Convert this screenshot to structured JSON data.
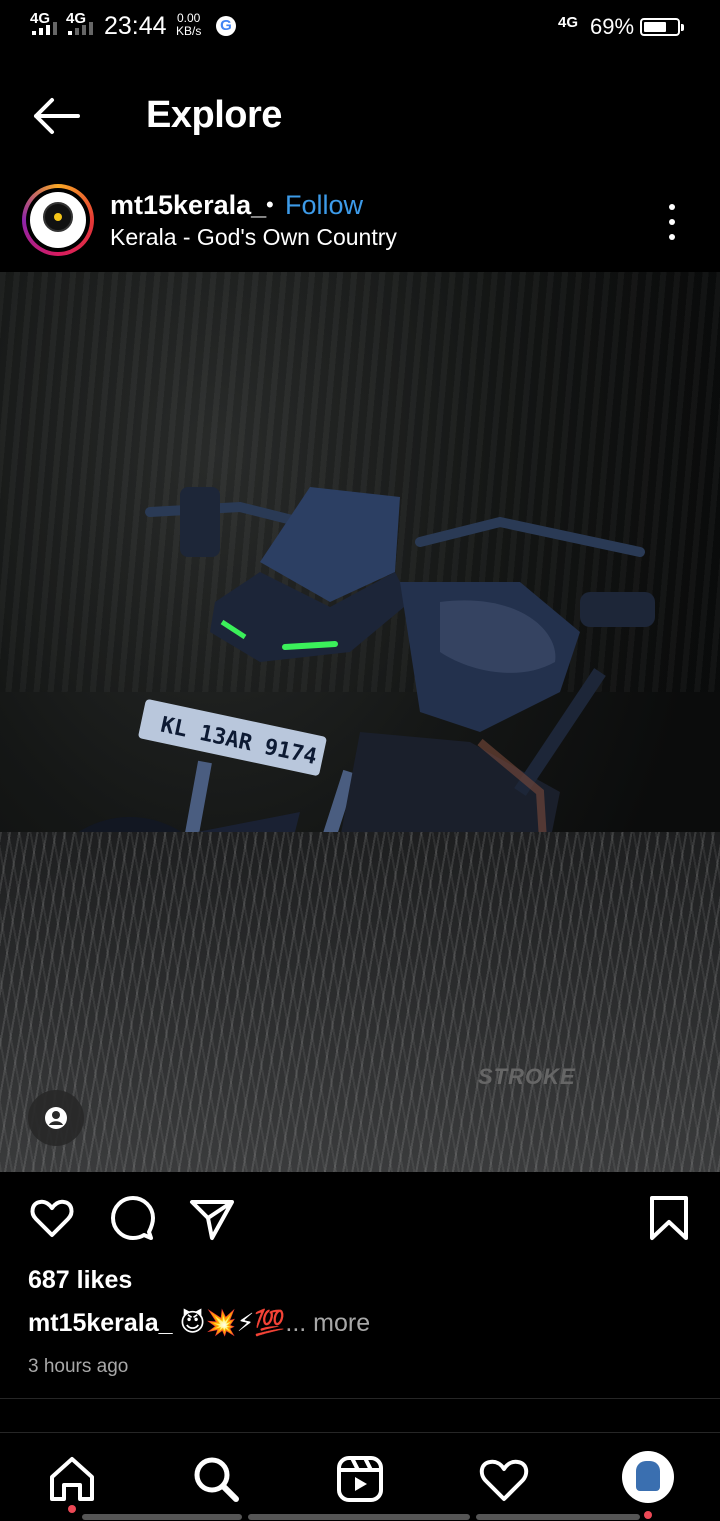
{
  "status_bar": {
    "net1": "4G",
    "net2": "4G",
    "time": "23:44",
    "speed_value": "0.00",
    "speed_unit": "KB/s",
    "g_icon": "G",
    "right_net": "4G",
    "battery_percent": "69%",
    "battery_level": 0.69
  },
  "header": {
    "title": "Explore",
    "back_icon": "arrow-left-icon"
  },
  "post": {
    "username": "mt15kerala_",
    "separator": "•",
    "follow_label": "Follow",
    "location": "Kerala - God's Own Country",
    "image_watermark": "STROKE",
    "likes": "687 likes",
    "caption_user": "mt15kerala_",
    "caption_text": " 😈💥⚡💯",
    "caption_more": "... more",
    "time_ago": "3 hours ago"
  },
  "icons": {
    "like": "heart-icon",
    "comment": "comment-icon",
    "share": "send-icon",
    "save": "bookmark-icon",
    "user_tag": "user-tag-icon",
    "menu": "more-vertical-icon"
  },
  "nav": {
    "items": [
      "home-icon",
      "search-icon",
      "reels-icon",
      "heart-icon",
      "profile-avatar"
    ]
  },
  "colors": {
    "follow": "#3d9be9",
    "notification_dot": "#ed4956",
    "background": "#000000"
  }
}
